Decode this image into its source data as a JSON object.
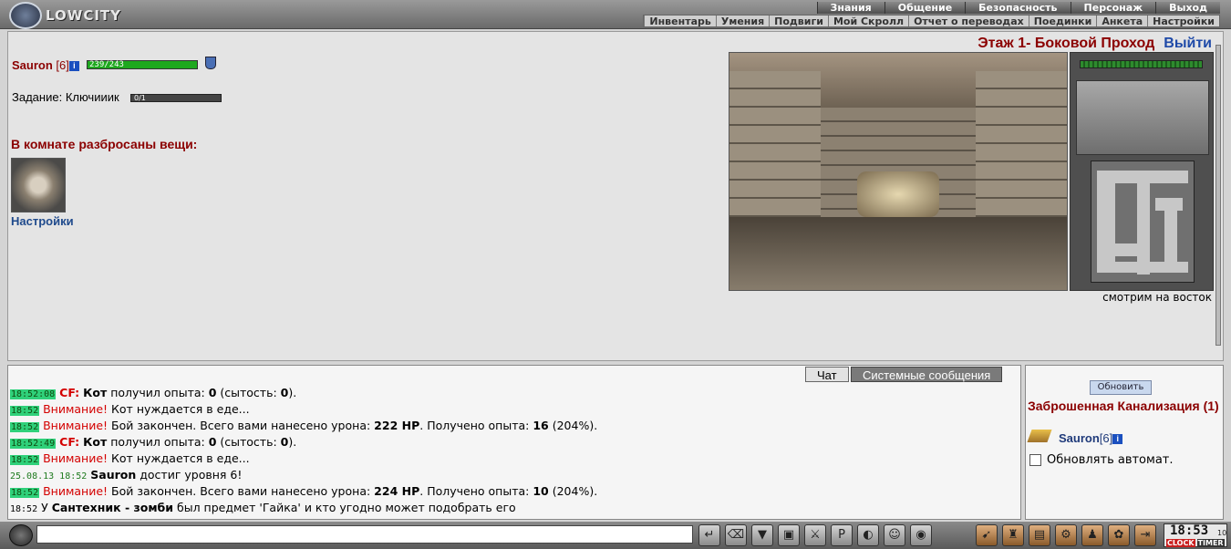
{
  "header": {
    "logo_text": "LOWCITY",
    "top_menu": [
      "Знания",
      "Общение",
      "Безопасность",
      "Персонаж",
      "Выход"
    ],
    "sub_menu": [
      "Инвентарь",
      "Умения",
      "Подвиги",
      "Мой Скролл",
      "Отчет о переводах",
      "Поединки",
      "Анкета",
      "Настройки"
    ]
  },
  "character": {
    "name": "Sauron",
    "level": "[6]",
    "hp": "239/243",
    "hp_fraction": 0.98
  },
  "quest": {
    "label": "Задание:",
    "name": "Ключииик",
    "progress": "0/1"
  },
  "room": {
    "items_heading": "В комнате разбросаны вещи:",
    "item_label": "Настройки"
  },
  "location": {
    "title": "Этаж 1- Боковой Проход",
    "exit": "Выйти",
    "facing": "смотрим на восток"
  },
  "chat": {
    "tabs": [
      "Чат",
      "Системные сообщения"
    ],
    "messages": [
      {
        "time": "18:52:08",
        "time_style": "hl",
        "prefix": "CF:",
        "bold": "Кот",
        "text": " получил опыта: ",
        "v1": "0",
        "text2": " (сытость: ",
        "v2": "0",
        "text3": ")."
      },
      {
        "time": "18:52",
        "time_style": "hl",
        "alert": "Внимание!",
        "text": " Кот нуждается в еде..."
      },
      {
        "time": "18:52",
        "time_style": "hl",
        "alert": "Внимание!",
        "text": " Бой закончен. Всего вами нанесено урона: ",
        "v1": "222 HP",
        "text2": ". Получено опыта: ",
        "v2": "16",
        "text3": " (204%)."
      },
      {
        "time": "18:52:49",
        "time_style": "hl",
        "prefix": "CF:",
        "bold": "Кот",
        "text": " получил опыта: ",
        "v1": "0",
        "text2": " (сытость: ",
        "v2": "0",
        "text3": ")."
      },
      {
        "time": "18:52",
        "time_style": "hl",
        "alert": "Внимание!",
        "text": " Кот нуждается в еде..."
      },
      {
        "time": "25.08.13 18:52",
        "time_style": "green",
        "bold": "Sauron",
        "text": " достиг уровня 6!"
      },
      {
        "time": "18:52",
        "time_style": "hl",
        "alert": "Внимание!",
        "text": " Бой закончен. Всего вами нанесено урона: ",
        "v1": "224 HP",
        "text2": ". Получено опыта: ",
        "v2": "10",
        "text3": " (204%)."
      },
      {
        "time": "18:52",
        "time_style": "plain",
        "text": "У ",
        "bold": "Сантехник - зомби",
        "text2": " был предмет 'Гайка' и кто угодно может подобрать его"
      }
    ]
  },
  "sidebar": {
    "refresh": "Обновить",
    "location": "Заброшенная Канализация (1)",
    "member_name": "Sauron",
    "member_level": "[6]",
    "auto_label": "Обновлять автомат."
  },
  "clock": {
    "time": "18:53",
    "seconds": "10",
    "clock_label": "CLOCK",
    "timer_label": "TIMER"
  },
  "colors": {
    "accent_red": "#8b0000",
    "link_blue": "#1f4a8c",
    "hp_green": "#1ea81e",
    "time_green": "#2fd17a"
  },
  "icons": {
    "toolbar": [
      "enter-icon",
      "eraser-icon",
      "filter-icon",
      "save-icon",
      "fight-icon",
      "pl-icon",
      "ear-icon",
      "smile-icon",
      "mask-icon"
    ],
    "toolbar2": [
      "run-icon",
      "bag-icon",
      "chest-icon",
      "gear-icon",
      "group-icon",
      "paw-icon",
      "exit-icon"
    ]
  }
}
